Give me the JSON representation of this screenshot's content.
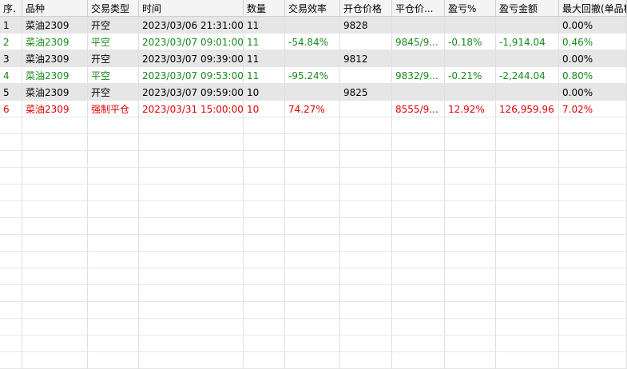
{
  "columns": [
    "序.",
    "品种",
    "交易类型",
    "时间",
    "数量",
    "交易效率",
    "开仓价格",
    "平仓价...",
    "盈亏%",
    "盈亏金额",
    "最大回撤(单品种"
  ],
  "rows": [
    {
      "cells": [
        "1",
        "菜油2309",
        "开空",
        "2023/03/06 21:31:00",
        "11",
        "",
        "9828",
        "",
        "",
        "",
        "0.00%"
      ],
      "color": "black",
      "highlight": true
    },
    {
      "cells": [
        "2",
        "菜油2309",
        "平空",
        "2023/03/07 09:01:00",
        "11",
        "-54.84%",
        "",
        "9845/9...",
        "-0.18%",
        "-1,914.04",
        "0.46%"
      ],
      "color": "green",
      "highlight": false
    },
    {
      "cells": [
        "3",
        "菜油2309",
        "开空",
        "2023/03/07 09:39:00",
        "11",
        "",
        "9812",
        "",
        "",
        "",
        "0.00%"
      ],
      "color": "black",
      "highlight": true
    },
    {
      "cells": [
        "4",
        "菜油2309",
        "平空",
        "2023/03/07 09:53:00",
        "11",
        "-95.24%",
        "",
        "9832/9...",
        "-0.21%",
        "-2,244.04",
        "0.80%"
      ],
      "color": "green",
      "highlight": false
    },
    {
      "cells": [
        "5",
        "菜油2309",
        "开空",
        "2023/03/07 09:59:00",
        "10",
        "",
        "9825",
        "",
        "",
        "",
        "0.00%"
      ],
      "color": "black",
      "highlight": true
    },
    {
      "cells": [
        "6",
        "菜油2309",
        "强制平仓",
        "2023/03/31 15:00:00",
        "10",
        "74.27%",
        "",
        "8555/9...",
        "12.92%",
        "126,959.96",
        "7.02%"
      ],
      "color": "red",
      "highlight": false
    }
  ],
  "colors": {
    "green": "#1a8a1a",
    "red": "#e00000",
    "highlight": "#e6e6e6",
    "gridline": "#e6e6e6"
  }
}
